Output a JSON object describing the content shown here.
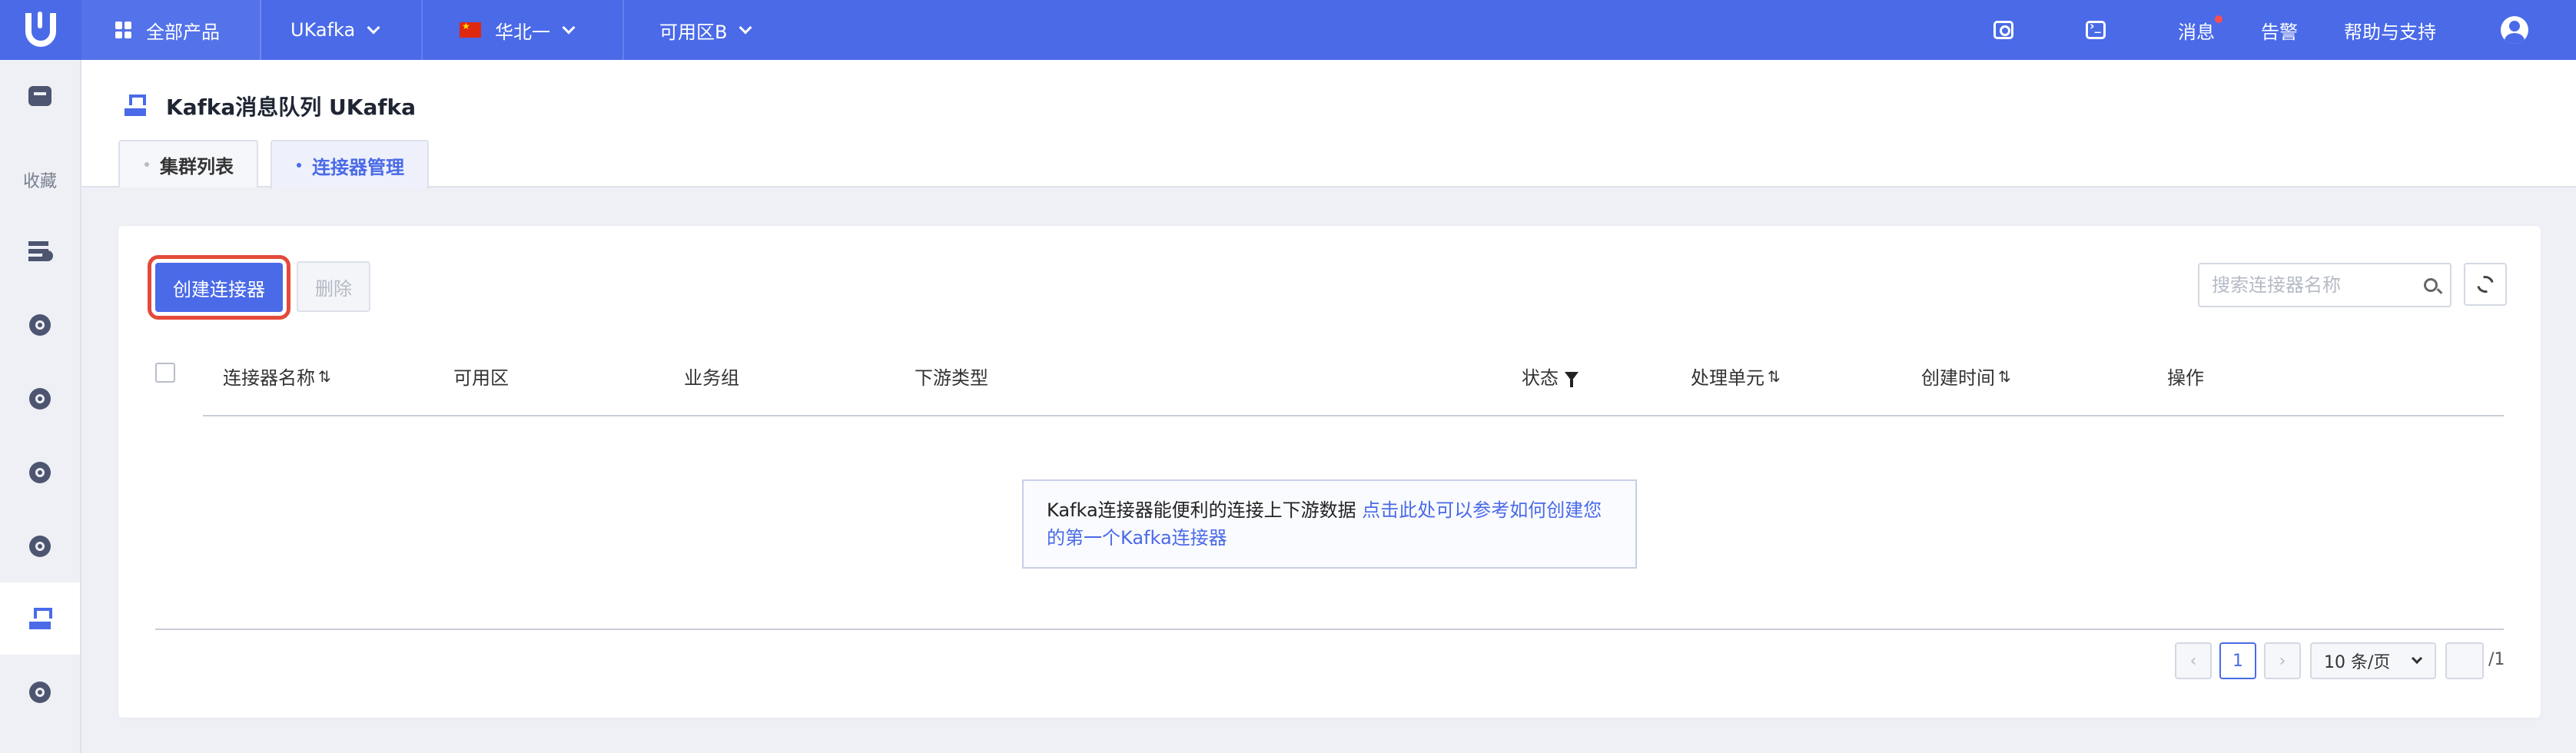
{
  "topnav": {
    "all_products": "全部产品",
    "product": "UKafka",
    "region": "华北一",
    "zone": "可用区B",
    "messages": "消息",
    "alerts": "告警",
    "help": "帮助与支持"
  },
  "sidebar": {
    "favorites_label": "收藏"
  },
  "header": {
    "title": "Kafka消息队列 UKafka",
    "tabs": [
      {
        "label": "集群列表",
        "active": false
      },
      {
        "label": "连接器管理",
        "active": true
      }
    ]
  },
  "toolbar": {
    "create_label": "创建连接器",
    "delete_label": "删除",
    "search_placeholder": "搜索连接器名称"
  },
  "table": {
    "columns": [
      "连接器名称",
      "可用区",
      "业务组",
      "下游类型",
      "状态",
      "处理单元",
      "创建时间",
      "操作"
    ],
    "rows": []
  },
  "empty": {
    "text": "Kafka连接器能便利的连接上下游数据 ",
    "link_text": "点击此处可以参考如何创建您的第一个Kafka连接器"
  },
  "pagination": {
    "prev": "‹",
    "current_page": "1",
    "next": "›",
    "page_size": "10 条/页",
    "total_pages": "/1"
  },
  "colors": {
    "primary": "#4a6ae8",
    "highlight_outline": "#e34a3a"
  }
}
